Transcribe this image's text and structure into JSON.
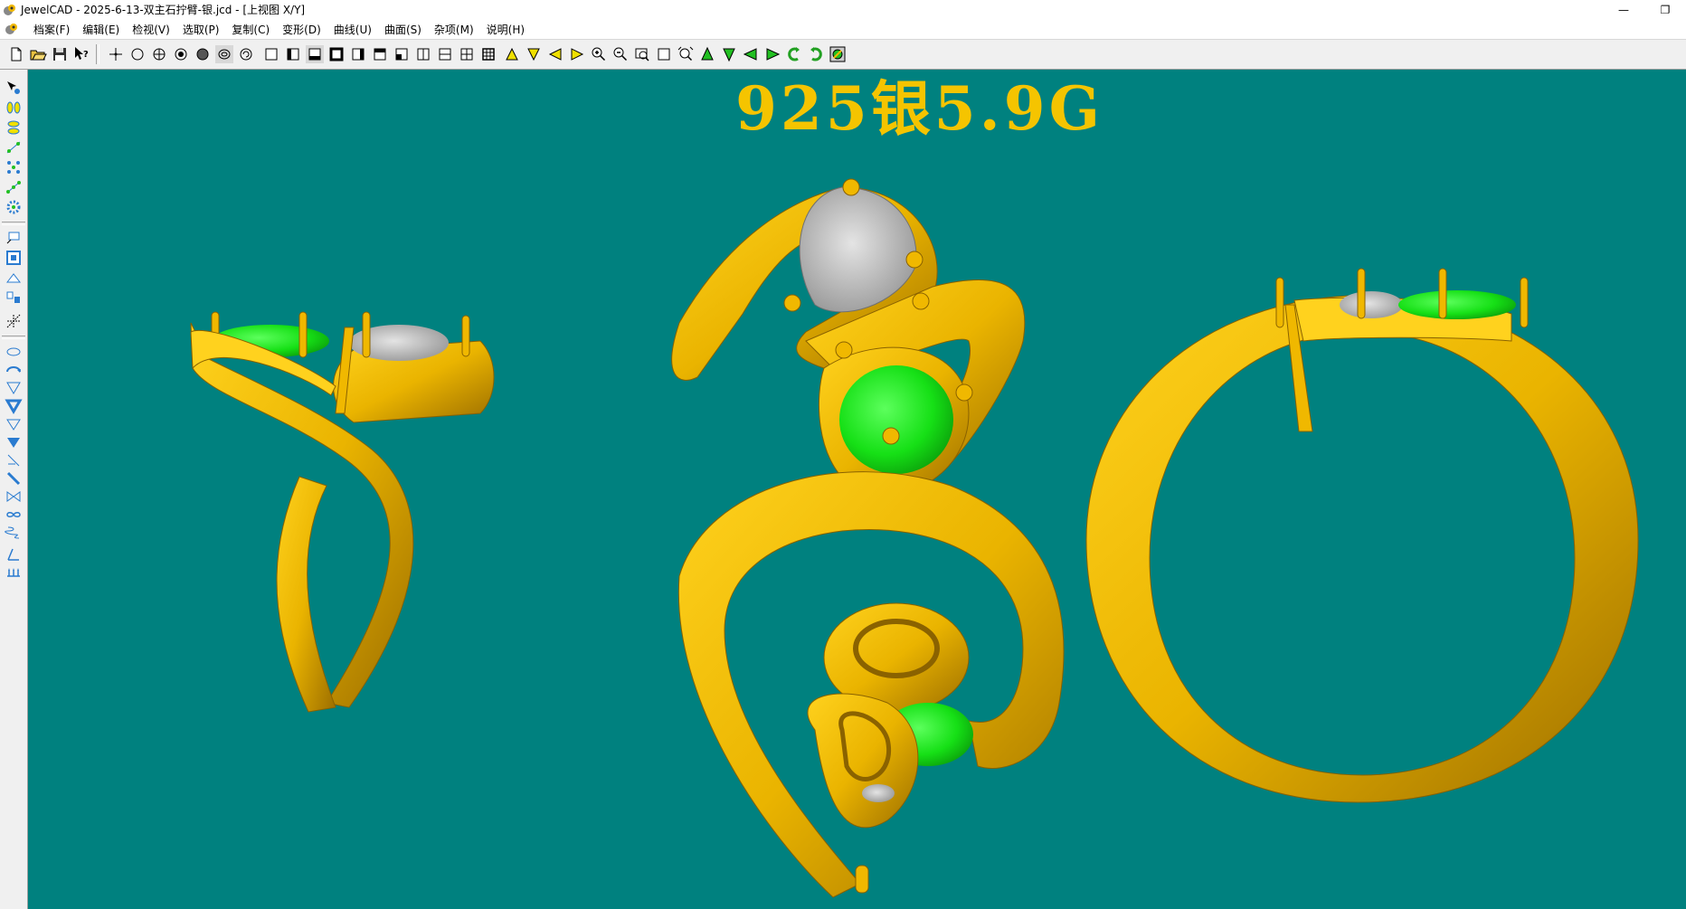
{
  "window": {
    "title": "JewelCAD - 2025-6-13-双主石拧臂-银.jcd - [上视图 X/Y]",
    "minimize_glyph": "—",
    "restore_glyph": "❐"
  },
  "menu": [
    {
      "label": "档案(F)"
    },
    {
      "label": "编辑(E)"
    },
    {
      "label": "检视(V)"
    },
    {
      "label": "选取(P)"
    },
    {
      "label": "复制(C)"
    },
    {
      "label": "变形(D)"
    },
    {
      "label": "曲线(U)"
    },
    {
      "label": "曲面(S)"
    },
    {
      "label": "杂项(M)"
    },
    {
      "label": "说明(H)"
    }
  ],
  "toolbar": {
    "buttons": [
      {
        "name": "new-file-icon"
      },
      {
        "name": "open-file-icon"
      },
      {
        "name": "save-icon"
      },
      {
        "name": "help-cursor-icon"
      },
      {
        "name": "point-icon"
      },
      {
        "name": "circle-icon"
      },
      {
        "name": "crosshair-circle-icon"
      },
      {
        "name": "dot-circle-icon"
      },
      {
        "name": "filled-circle-icon"
      },
      {
        "name": "ellipse-icon"
      },
      {
        "name": "rotate-circle-icon"
      },
      {
        "name": "square-icon"
      },
      {
        "name": "half-square-left-icon"
      },
      {
        "name": "half-square-bottom-icon"
      },
      {
        "name": "bold-square-icon"
      },
      {
        "name": "half-square-right-icon"
      },
      {
        "name": "half-square-top-icon"
      },
      {
        "name": "quarter-square-icon"
      },
      {
        "name": "split-vertical-icon"
      },
      {
        "name": "split-horizontal-icon"
      },
      {
        "name": "grid-four-icon"
      },
      {
        "name": "grid-nine-icon"
      },
      {
        "name": "triangle-up-icon"
      },
      {
        "name": "triangle-down-icon"
      },
      {
        "name": "triangle-left-icon"
      },
      {
        "name": "triangle-right-icon"
      },
      {
        "name": "zoom-in-icon"
      },
      {
        "name": "zoom-out-icon"
      },
      {
        "name": "zoom-window-icon"
      },
      {
        "name": "zoom-box-icon"
      },
      {
        "name": "zoom-fit-icon"
      },
      {
        "name": "arrow-up-green-icon"
      },
      {
        "name": "arrow-down-green-icon"
      },
      {
        "name": "arrow-left-green-icon"
      },
      {
        "name": "arrow-right-green-icon"
      },
      {
        "name": "rotate-left-icon"
      },
      {
        "name": "rotate-right-icon"
      },
      {
        "name": "render-view-icon"
      }
    ]
  },
  "lefttools": {
    "buttons": [
      {
        "name": "select-points-icon"
      },
      {
        "name": "select-curves-icon"
      },
      {
        "name": "select-surfaces-icon"
      },
      {
        "name": "node-edit-icon"
      },
      {
        "name": "node-grid-icon"
      },
      {
        "name": "node-link-icon"
      },
      {
        "name": "gear-node-icon"
      },
      {
        "name": "text-box-icon"
      },
      {
        "name": "frame-select-icon"
      },
      {
        "name": "arc-curve-icon"
      },
      {
        "name": "mirror-copy-icon"
      },
      {
        "name": "axis-icon"
      },
      {
        "name": "loop-curve-icon"
      },
      {
        "name": "arrow-curve-icon"
      },
      {
        "name": "funnel-icon"
      },
      {
        "name": "funnel-bold-icon"
      },
      {
        "name": "funnel-outline-icon"
      },
      {
        "name": "funnel-filled-icon"
      },
      {
        "name": "diagonal-line-icon"
      },
      {
        "name": "diagonal-bold-icon"
      },
      {
        "name": "bowtie-icon"
      },
      {
        "name": "infinity-icon"
      },
      {
        "name": "spring-icon"
      },
      {
        "name": "measure-icon"
      },
      {
        "name": "ruler-ticks-icon"
      }
    ]
  },
  "viewport": {
    "overlay_text": "925银5.9G",
    "background": "#00817f",
    "metal_color": "#f0b800",
    "metal_shadow": "#9c6e00",
    "gem_green": "#22e622",
    "gem_white": "#c8c8c8",
    "views": [
      {
        "name": "side-view"
      },
      {
        "name": "top-view"
      },
      {
        "name": "bottom-view"
      },
      {
        "name": "front-view"
      }
    ]
  }
}
